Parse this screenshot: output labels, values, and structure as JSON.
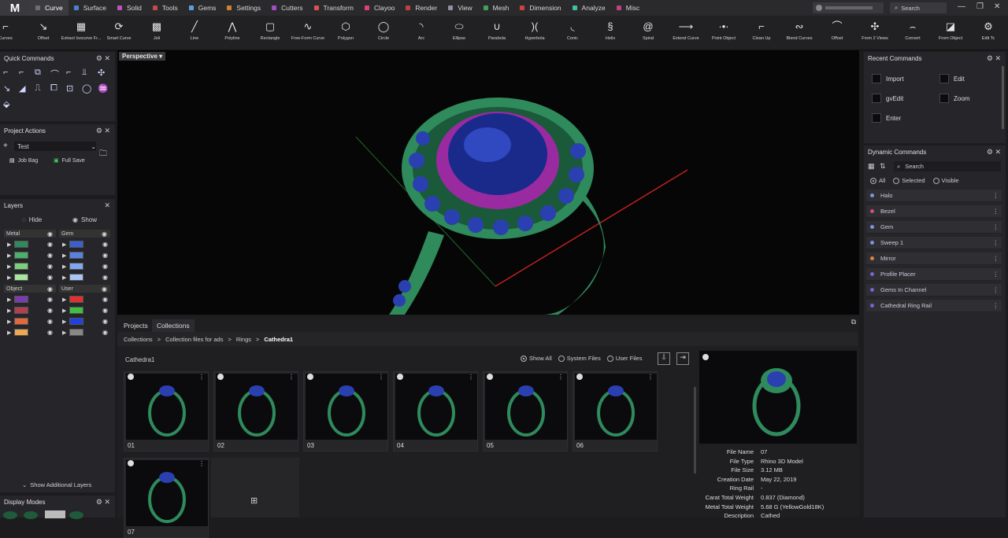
{
  "app": {
    "logo": "M"
  },
  "menu_tabs": [
    {
      "label": "Curve",
      "color": "#6b6f7a",
      "active": true
    },
    {
      "label": "Surface",
      "color": "#4a7fd0"
    },
    {
      "label": "Solid",
      "color": "#c050c0"
    },
    {
      "label": "Tools",
      "color": "#c24a4a"
    },
    {
      "label": "Gems",
      "color": "#5aa0e0"
    },
    {
      "label": "Settings",
      "color": "#d08030"
    },
    {
      "label": "Cutters",
      "color": "#a050c0"
    },
    {
      "label": "Transform",
      "color": "#e05050"
    },
    {
      "label": "Clayoo",
      "color": "#e04070"
    },
    {
      "label": "Render",
      "color": "#c04040"
    },
    {
      "label": "View",
      "color": "#9090a0"
    },
    {
      "label": "Mesh",
      "color": "#40a060"
    },
    {
      "label": "Dimension",
      "color": "#d04040"
    },
    {
      "label": "Analyze",
      "color": "#40c0a0"
    },
    {
      "label": "Misc",
      "color": "#c04080"
    }
  ],
  "topbar": {
    "search_placeholder": "Search"
  },
  "tools": [
    {
      "label": "Curves",
      "icon": "⌐"
    },
    {
      "label": "Offset",
      "icon": "↘"
    },
    {
      "label": "Extract Isocurve Fr...",
      "icon": "▦"
    },
    {
      "label": "Smart Curve",
      "icon": "⟳"
    },
    {
      "label": "Jeli",
      "icon": "▩"
    },
    {
      "label": "Line",
      "icon": "╱"
    },
    {
      "label": "Polyline",
      "icon": "⋀"
    },
    {
      "label": "Rectangle",
      "icon": "▢"
    },
    {
      "label": "Free-Form Curve",
      "icon": "∿"
    },
    {
      "label": "Polygon",
      "icon": "⬡"
    },
    {
      "label": "Circle",
      "icon": "◯"
    },
    {
      "label": "Arc",
      "icon": "◝"
    },
    {
      "label": "Ellipse",
      "icon": "⬭"
    },
    {
      "label": "Parabola",
      "icon": "∪"
    },
    {
      "label": "Hyperbola",
      "icon": ")("
    },
    {
      "label": "Conic",
      "icon": "◟"
    },
    {
      "label": "Helix",
      "icon": "§"
    },
    {
      "label": "Spiral",
      "icon": "@"
    },
    {
      "label": "Extend Curve",
      "icon": "⟶"
    },
    {
      "label": "Point Object",
      "icon": "·•·"
    },
    {
      "label": "Clean Up",
      "icon": "⌐"
    },
    {
      "label": "Blend Curves",
      "icon": "∾"
    },
    {
      "label": "Offset",
      "icon": "⌒"
    },
    {
      "label": "From 2 Views",
      "icon": "✣"
    },
    {
      "label": "Convert",
      "icon": "⌢"
    },
    {
      "label": "From Object",
      "icon": "◪"
    },
    {
      "label": "Edit Tc",
      "icon": "⚙"
    }
  ],
  "quick_commands": {
    "title": "Quick Commands"
  },
  "project_actions": {
    "title": "Project Actions",
    "project": "Test",
    "job_bag": "Job Bag",
    "full_save": "Full Save"
  },
  "layers": {
    "title": "Layers",
    "hide": "Hide",
    "show": "Show",
    "col1": "Metal",
    "col2": "Gem",
    "col3": "Object",
    "col4": "User",
    "metal_colors": [
      "#2e8a5a",
      "#4ab06a",
      "#7ad07a",
      "#a6e6a0"
    ],
    "gem_colors": [
      "#3a5fd0",
      "#5a80e0",
      "#80a8f0",
      "#aac4f6"
    ],
    "object_colors": [
      "#7a3ab0",
      "#b04050",
      "#e06a3a",
      "#f0a850"
    ],
    "user_colors": [
      "#e03030",
      "#40c040",
      "#2040e0",
      "#888888"
    ],
    "show_additional": "Show Additional Layers"
  },
  "display_modes": {
    "title": "Display Modes"
  },
  "viewport": {
    "label": "Perspective"
  },
  "browser": {
    "tabs": [
      "Projects",
      "Collections"
    ],
    "breadcrumb": [
      "Collections",
      "Collection files for ads",
      "Rings",
      "Cathedra1"
    ],
    "folder_name": "Cathedra1",
    "filters": [
      "Show All",
      "System Files",
      "User Files"
    ],
    "items": [
      "01",
      "02",
      "03",
      "04",
      "05",
      "06",
      "07"
    ]
  },
  "file_info": [
    {
      "key": "File Name",
      "value": "07"
    },
    {
      "key": "File Type",
      "value": "Rhino 3D Model"
    },
    {
      "key": "File Size",
      "value": "3.12 MB"
    },
    {
      "key": "Creation Date",
      "value": "May 22, 2019"
    },
    {
      "key": "Ring Rail",
      "value": "-"
    },
    {
      "key": "Carat Total Weight",
      "value": "0.837 (Diamond)"
    },
    {
      "key": "Metal Total Weight",
      "value": "5.68 G (YellowGold18K)"
    },
    {
      "key": "Description",
      "value": "Cathed"
    }
  ],
  "recent_commands": {
    "title": "Recent Commands",
    "items": [
      "Import",
      "Edit",
      "gvEdit",
      "Zoom",
      "Enter"
    ]
  },
  "dynamic_commands": {
    "title": "Dynamic Commands",
    "search_placeholder": "Search",
    "filters": [
      "All",
      "Selected",
      "Visible"
    ],
    "items": [
      {
        "label": "Halo",
        "color": "#8090e0"
      },
      {
        "label": "Bezel",
        "color": "#d05070"
      },
      {
        "label": "Gem",
        "color": "#8090e0"
      },
      {
        "label": "Sweep 1",
        "color": "#8090e0"
      },
      {
        "label": "Mirror",
        "color": "#e08040"
      },
      {
        "label": "Profile Placer",
        "color": "#8060d0"
      },
      {
        "label": "Gems In Channel",
        "color": "#8060d0"
      },
      {
        "label": "Cathedral Ring Rail",
        "color": "#8060d0"
      }
    ]
  }
}
